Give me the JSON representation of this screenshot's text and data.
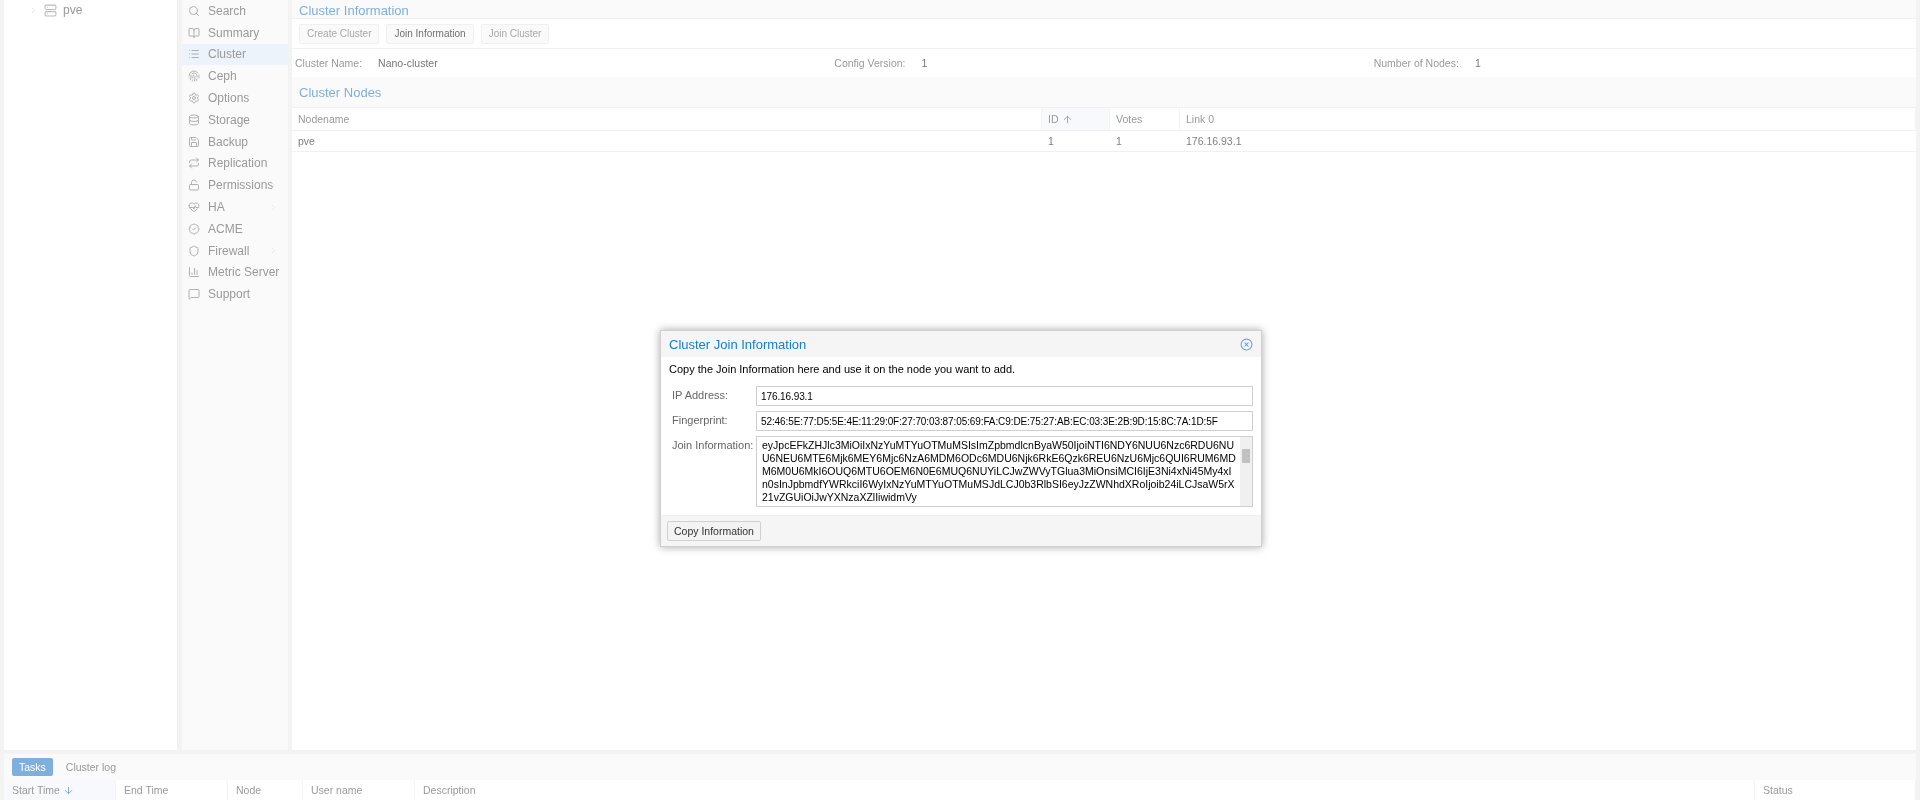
{
  "tree": [
    {
      "label": "pve",
      "expanded": false
    }
  ],
  "nav": [
    {
      "label": "Search",
      "selected": false,
      "submenu": false
    },
    {
      "label": "Summary",
      "selected": false,
      "submenu": false
    },
    {
      "label": "Cluster",
      "selected": true,
      "submenu": false
    },
    {
      "label": "Ceph",
      "selected": false,
      "submenu": false
    },
    {
      "label": "Options",
      "selected": false,
      "submenu": false
    },
    {
      "label": "Storage",
      "selected": false,
      "submenu": false
    },
    {
      "label": "Backup",
      "selected": false,
      "submenu": false
    },
    {
      "label": "Replication",
      "selected": false,
      "submenu": false
    },
    {
      "label": "Permissions",
      "selected": false,
      "submenu": true
    },
    {
      "label": "HA",
      "selected": false,
      "submenu": true
    },
    {
      "label": "ACME",
      "selected": false,
      "submenu": false
    },
    {
      "label": "Firewall",
      "selected": false,
      "submenu": true
    },
    {
      "label": "Metric Server",
      "selected": false,
      "submenu": false
    },
    {
      "label": "Support",
      "selected": false,
      "submenu": false
    }
  ],
  "cluster_info": {
    "title": "Cluster Information",
    "buttons": [
      {
        "label": "Create Cluster",
        "disabled": true
      },
      {
        "label": "Join Information",
        "disabled": false
      },
      {
        "label": "Join Cluster",
        "disabled": true
      }
    ],
    "fields": [
      {
        "label": "Cluster Name:",
        "value": "Nano-cluster"
      },
      {
        "label": "Config Version:",
        "value": "1"
      },
      {
        "label": "Number of Nodes:",
        "value": "1"
      }
    ]
  },
  "cluster_nodes": {
    "title": "Cluster Nodes",
    "columns": [
      {
        "label": "Nodename",
        "sorted": false
      },
      {
        "label": "ID",
        "sorted": true,
        "descending": false
      },
      {
        "label": "Votes",
        "sorted": false
      },
      {
        "label": "Link 0",
        "sorted": false
      }
    ],
    "rows": [
      [
        "pve",
        "1",
        "1",
        "176.16.93.1"
      ]
    ]
  },
  "dialog": {
    "title": "Cluster Join Information",
    "message": "Copy the Join Information here and use it on the node you want to add.",
    "fields": [
      {
        "label": "IP Address:",
        "value": "176.16.93.1",
        "kind": "text"
      },
      {
        "label": "Fingerprint:",
        "value": "52:46:5E:77:D5:5E:4E:11:29:0F:27:70:03:87:05:69:FA:C9:DE:75:27:AB:EC:03:3E:2B:9D:15:8C:7A:1D:5F",
        "kind": "text"
      },
      {
        "label": "Join Information:",
        "value": "eyJpcEFkZHJlc3MiOiIxNzYuMTYuOTMuMSIsImZpbmdlcnByaW50IjoiNTI6NDY6NUU6Nzc6RDU6NUU6NEU6MTE6Mjk6MEY6Mjc6NzA6MDM6ODc6MDU6Njk6RkE6Qzk6REU6NzU6Mjc6QUI6RUM6MDM6M0U6MkI6OUQ6MTU6OEM6N0E6MUQ6NUYiLCJwZWVyTGlua3MiOnsiMCI6IjE3Ni4xNi45My4xIn0sInJpbmdfYWRkciI6WyIxNzYuMTYuOTMuMSJdLCJ0b3RlbSI6eyJzZWNhdXRoIjoib24iLCJsaW5rX21vZGUiOiJwYXNzaXZlIiwidmVy",
        "kind": "textarea"
      }
    ],
    "button": "Copy Information"
  },
  "bottom": {
    "tabs": [
      {
        "label": "Tasks",
        "selected": true
      },
      {
        "label": "Cluster log",
        "selected": false
      }
    ],
    "columns": [
      {
        "label": "Start Time",
        "sorted": true,
        "descending": true
      },
      {
        "label": "End Time",
        "sorted": false
      },
      {
        "label": "Node",
        "sorted": false
      },
      {
        "label": "User name",
        "sorted": false
      },
      {
        "label": "Description",
        "sorted": false
      },
      {
        "label": "Status",
        "sorted": false
      }
    ]
  }
}
